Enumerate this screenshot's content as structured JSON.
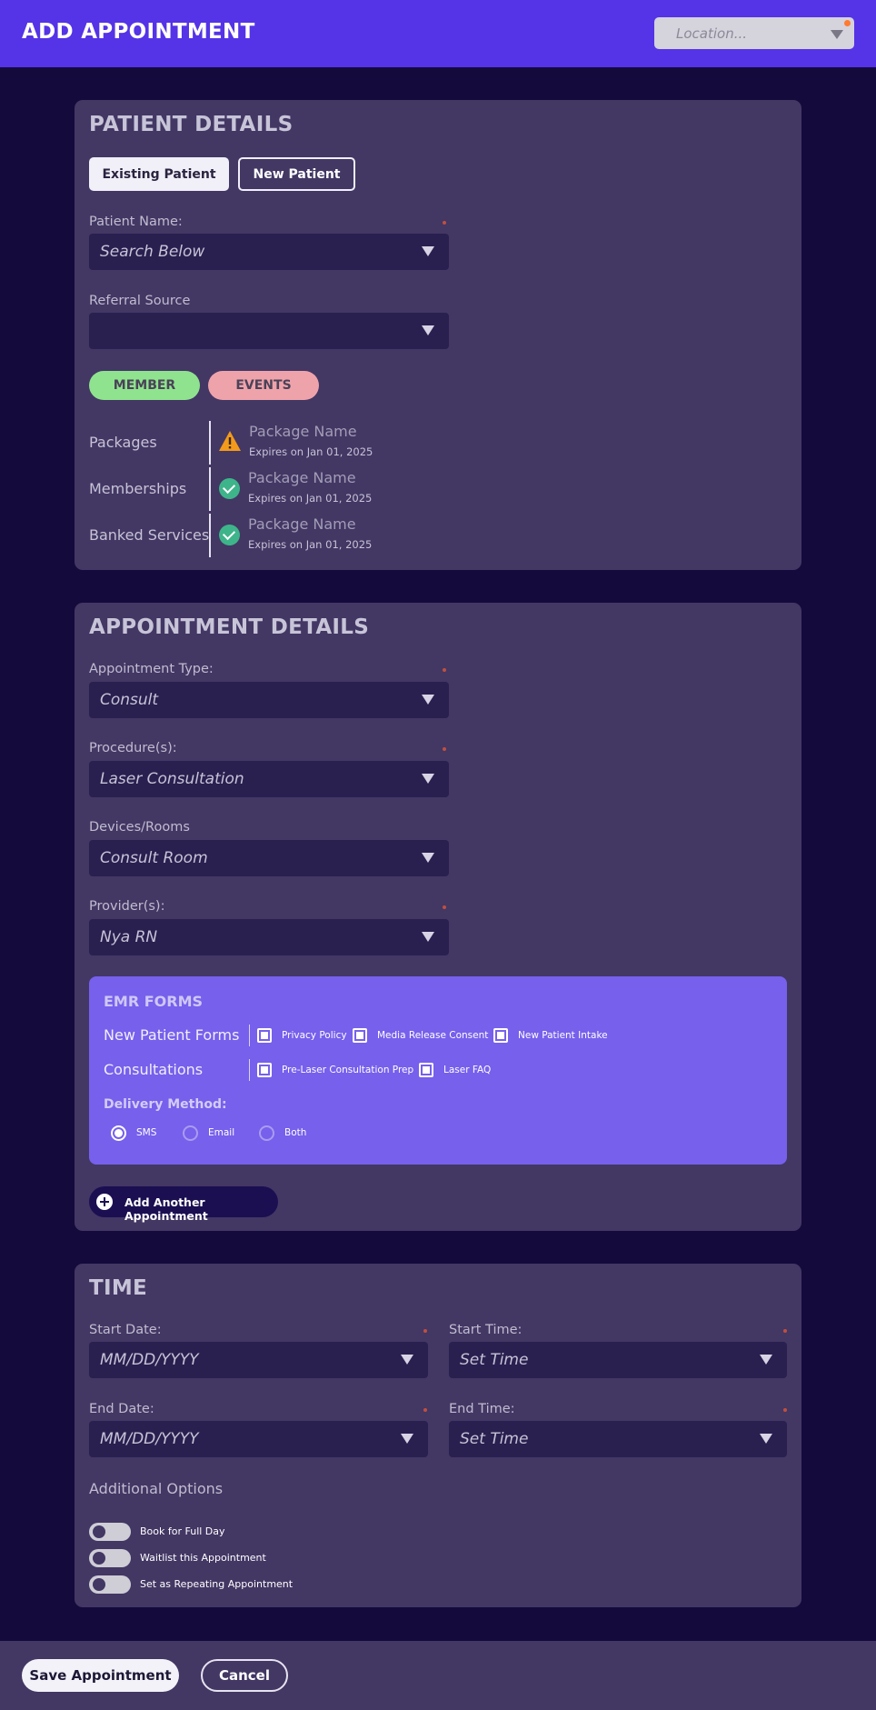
{
  "header": {
    "title": "ADD APPOINTMENT",
    "location_placeholder": "Location..."
  },
  "patient_details": {
    "title": "PATIENT DETAILS",
    "existing_patient_label": "Existing Patient",
    "new_patient_label": "New Patient",
    "patient_name_label": "Patient Name:",
    "patient_name_value": "Search Below",
    "referral_source_label": "Referral Source",
    "referral_source_value": "",
    "member_label": "MEMBER",
    "events_label": "EVENTS",
    "packages": [
      {
        "label": "Packages",
        "name": "Package Name",
        "expires": "Expires on Jan 01, 2025",
        "status": "warning-icon"
      },
      {
        "label": "Memberships",
        "name": "Package Name",
        "expires": "Expires on Jan 01, 2025",
        "status": "check-icon"
      },
      {
        "label": "Banked Services",
        "name": "Package Name",
        "expires": "Expires on Jan 01, 2025",
        "status": "check-icon"
      }
    ]
  },
  "appointment_details": {
    "title": "APPOINTMENT DETAILS",
    "fields": [
      {
        "label": "Appointment Type:",
        "value": "Consult",
        "required": true
      },
      {
        "label": "Procedure(s):",
        "value": "Laser Consultation",
        "required": true
      },
      {
        "label": "Devices/Rooms",
        "value": "Consult Room",
        "required": false
      },
      {
        "label": "Provider(s):",
        "value": "Nya RN",
        "required": true
      }
    ],
    "emr_forms": {
      "title": "EMR FORMS",
      "new_patient_forms_label": "New Patient Forms",
      "new_patient_forms": [
        "Privacy Policy",
        "Media Release Consent",
        "New Patient Intake"
      ],
      "consultations_label": "Consultations",
      "consultations": [
        "Pre-Laser Consultation Prep",
        "Laser FAQ"
      ],
      "delivery_method_label": "Delivery Method:",
      "delivery_options": [
        "SMS",
        "Email",
        "Both"
      ],
      "delivery_selected": "SMS"
    },
    "add_another_label": "Add Another Appointment"
  },
  "time": {
    "title": "TIME",
    "start_date_label": "Start Date:",
    "start_date_value": "MM/DD/YYYY",
    "start_time_label": "Start Time:",
    "start_time_value": "Set Time",
    "end_date_label": "End Date:",
    "end_date_value": "MM/DD/YYYY",
    "end_time_label": "End Time:",
    "end_time_value": "Set Time",
    "additional_options_label": "Additional Options",
    "options": [
      "Book for Full Day",
      "Waitlist this Appointment",
      "Set as Repeating Appointment"
    ]
  },
  "footer": {
    "save_label": "Save Appointment",
    "cancel_label": "Cancel"
  },
  "colors": {
    "header": "#5533e6",
    "background": "#140a3c",
    "card": "#433764",
    "emr_panel": "#7660ec",
    "member_pill": "#8fe38e",
    "events_pill": "#eea3ab"
  }
}
